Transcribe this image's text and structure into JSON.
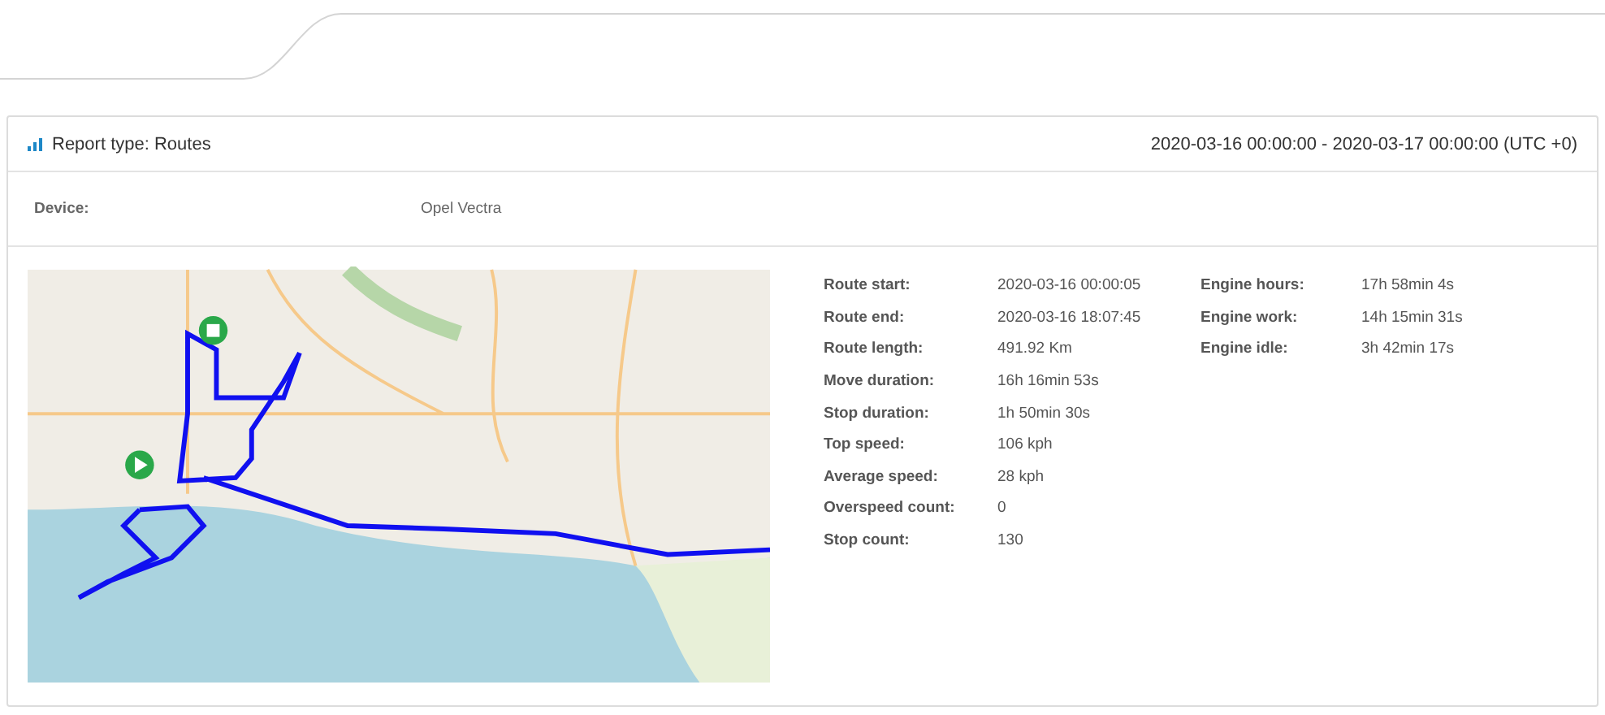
{
  "report": {
    "title": "Report type: Routes",
    "period": "2020-03-16 00:00:00 - 2020-03-17 00:00:00 (UTC +0)"
  },
  "device": {
    "label": "Device:",
    "value": "Opel Vectra"
  },
  "stats_columns": [
    [
      {
        "label": "Route start:",
        "value": "2020-03-16 00:00:05"
      },
      {
        "label": "Route end:",
        "value": "2020-03-16 18:07:45"
      },
      {
        "label": "Route length:",
        "value": "491.92 Km"
      },
      {
        "label": "Move duration:",
        "value": "16h 16min 53s"
      },
      {
        "label": "Stop duration:",
        "value": "1h 50min 30s"
      },
      {
        "label": "Top speed:",
        "value": "106 kph"
      },
      {
        "label": "Average speed:",
        "value": "28 kph"
      },
      {
        "label": "Overspeed count:",
        "value": "0"
      },
      {
        "label": "Stop count:",
        "value": "130"
      }
    ],
    [
      {
        "label": "Engine hours:",
        "value": "17h 58min 4s"
      },
      {
        "label": "Engine work:",
        "value": "14h 15min 31s"
      },
      {
        "label": "Engine idle:",
        "value": "3h 42min 17s"
      }
    ]
  ]
}
